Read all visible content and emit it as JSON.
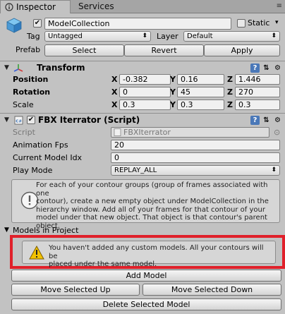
{
  "tabs": [
    {
      "label": "Inspector"
    },
    {
      "label": "Services"
    }
  ],
  "header": {
    "object_name": "ModelCollection",
    "static_label": "Static",
    "tag_label": "Tag",
    "tag_value": "Untagged",
    "layer_label": "Layer",
    "layer_value": "Default",
    "prefab_label": "Prefab",
    "select_button": "Select",
    "revert_button": "Revert",
    "apply_button": "Apply"
  },
  "transform": {
    "title": "Transform",
    "position_label": "Position",
    "rotation_label": "Rotation",
    "scale_label": "Scale",
    "x_label": "X",
    "y_label": "Y",
    "z_label": "Z",
    "position": {
      "x": "-0.382",
      "y": "0.16",
      "z": "1.446"
    },
    "rotation": {
      "x": "0",
      "y": "45",
      "z": "270"
    },
    "scale": {
      "x": "0.3",
      "y": "0.3",
      "z": "0.3"
    }
  },
  "fbx": {
    "title": "FBX Iterrator (Script)",
    "script_label": "Script",
    "script_value": "FBXIterrator",
    "animation_fps_label": "Animation Fps",
    "animation_fps_value": "20",
    "current_model_idx_label": "Current Model Idx",
    "current_model_idx_value": "0",
    "play_mode_label": "Play Mode",
    "play_mode_value": "REPLAY_ALL",
    "info_lines": [
      "For each of your contour groups (group of frames associated with one",
      "contour), create a new empty object under ModelCollection in the",
      "hierarchy window. Add all of your frames for that contour of your",
      "model under that new object. That object is that contour's parent",
      "object."
    ],
    "models_in_project_label": "Models in Project",
    "warning_lines": [
      "You haven't added any custom models. All your contours will be",
      "placed under the same model."
    ],
    "add_model_button": "Add Model",
    "move_up_button": "Move Selected Up",
    "move_down_button": "Move Selected Down",
    "delete_button": "Delete Selected Model"
  },
  "colors": {
    "panel_bg": "#c2c2c2",
    "highlight": "#e0202a",
    "warning_yellow": "#f2c200"
  }
}
